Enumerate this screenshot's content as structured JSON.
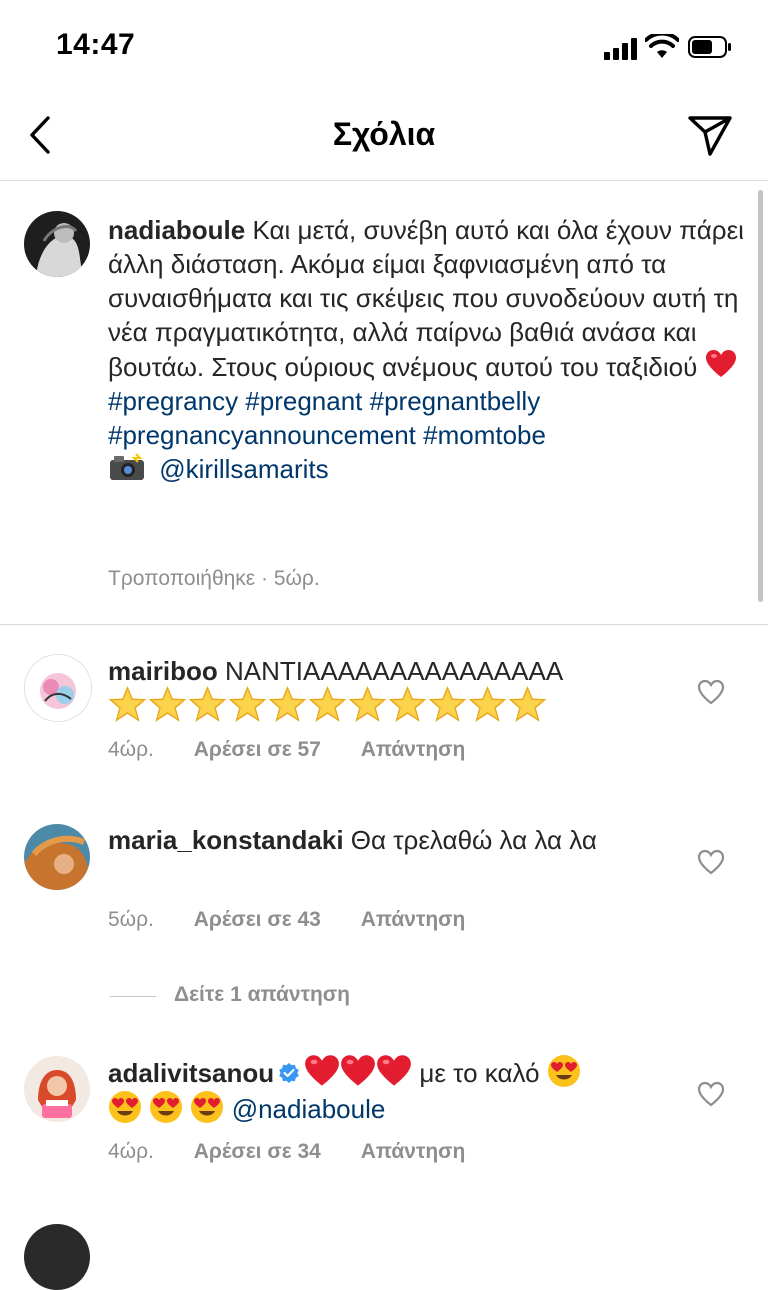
{
  "status_bar": {
    "time": "14:47"
  },
  "header": {
    "title": "Σχόλια"
  },
  "caption": {
    "username": "nadiaboule",
    "text": "Και μετά, συνέβη αυτό και όλα έχουν πάρει άλλη διάσταση. Ακόμα είμαι ξαφνιασμένη από τα συναισθήματα και τις σκέψεις που συνοδεύουν αυτή τη νέα πραγματικότητα, αλλά παίρνω βαθιά ανάσα και βουτάω. Στους ούριους ανέμους αυτού του ταξιδιού",
    "hashtags_line1": "#pregrancy #pregnant #pregnantbelly",
    "hashtags_line2": "#pregnancyannouncement #momtobe",
    "credit_mention": "@kirillsamarits",
    "meta": "Τροποποιήθηκε · 5ώρ."
  },
  "comments": [
    {
      "username": "mairiboo",
      "text": "ΝΑΝΤΙΑΑΑΑΑΑΑΑΑΑΑΑΑΑΑ",
      "star_count": 11,
      "time": "4ώρ.",
      "likes": "Αρέσει σε 57",
      "reply": "Απάντηση"
    },
    {
      "username": "maria_konstandaki",
      "text": "Θα τρελαθώ λα λα λα",
      "time": "5ώρ.",
      "likes": "Αρέσει σε 43",
      "reply": "Απάντηση",
      "view_replies": "Δείτε 1 απάντηση"
    },
    {
      "username": "adalivitsanou",
      "text": "με το καλό",
      "mention": "@nadiaboule",
      "time": "4ώρ.",
      "likes": "Αρέσει σε 34",
      "reply": "Απάντηση"
    }
  ],
  "colors": {
    "text": "#262626",
    "link": "#00376b",
    "muted": "#8e8e8e",
    "divider": "#dbdbdb",
    "verified": "#3897f0"
  }
}
